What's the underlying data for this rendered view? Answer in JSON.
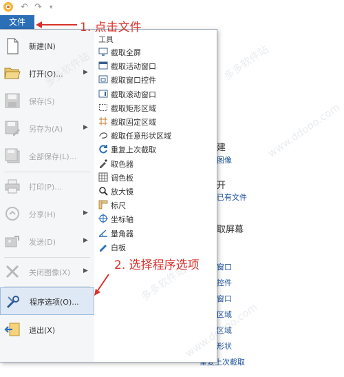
{
  "quick_access": {
    "app_icon": "app-logo-icon",
    "undo_icon": "undo-icon",
    "redo_icon": "redo-icon",
    "customize_icon": "dropdown-icon"
  },
  "file_tab": {
    "label": "文件"
  },
  "menu_items": [
    {
      "label": "新建(N)",
      "icon": "new-file-icon",
      "submenu": false,
      "disabled": false
    },
    {
      "label": "打开(O)...",
      "icon": "open-folder-icon",
      "submenu": true,
      "disabled": false
    },
    {
      "label": "保存(S)",
      "icon": "save-icon",
      "submenu": false,
      "disabled": true
    },
    {
      "label": "另存为(A)",
      "icon": "save-as-icon",
      "submenu": true,
      "disabled": true
    },
    {
      "label": "全部保存(L)...",
      "icon": "save-all-icon",
      "submenu": false,
      "disabled": true
    },
    {
      "label": "打印(P)...",
      "icon": "print-icon",
      "submenu": false,
      "disabled": true
    },
    {
      "label": "分享(H)",
      "icon": "share-icon",
      "submenu": true,
      "disabled": true
    },
    {
      "label": "发送(D)",
      "icon": "send-icon",
      "submenu": true,
      "disabled": true
    },
    {
      "label": "关闭图像(X)",
      "icon": "close-image-icon",
      "submenu": true,
      "disabled": true
    },
    {
      "label": "程序选项(O)...",
      "icon": "wrench-icon",
      "submenu": false,
      "disabled": false,
      "selected": true
    },
    {
      "label": "退出(X)",
      "icon": "exit-icon",
      "submenu": false,
      "disabled": false
    }
  ],
  "tools": {
    "header": "工具",
    "items": [
      {
        "label": "截取全屏",
        "icon": "monitor-icon"
      },
      {
        "label": "截取活动窗口",
        "icon": "window-icon"
      },
      {
        "label": "截取窗口控件",
        "icon": "window-control-icon"
      },
      {
        "label": "截取滚动窗口",
        "icon": "scroll-window-icon"
      },
      {
        "label": "截取矩形区域",
        "icon": "rectangle-icon"
      },
      {
        "label": "截取固定区域",
        "icon": "fixed-region-icon"
      },
      {
        "label": "截取任意形状区域",
        "icon": "freeform-icon"
      },
      {
        "label": "重复上次截取",
        "icon": "repeat-icon"
      },
      {
        "label": "取色器",
        "icon": "eyedropper-icon"
      },
      {
        "label": "调色板",
        "icon": "palette-icon"
      },
      {
        "label": "放大镜",
        "icon": "magnifier-icon"
      },
      {
        "label": "标尺",
        "icon": "ruler-icon"
      },
      {
        "label": "坐标轴",
        "icon": "crosshair-icon"
      },
      {
        "label": "量角器",
        "icon": "protractor-icon"
      },
      {
        "label": "白板",
        "icon": "whiteboard-icon"
      }
    ]
  },
  "background": {
    "items": [
      "建",
      "图像",
      "开",
      "已有文件",
      "取屏幕",
      "窗口",
      "控件",
      "窗口",
      "区域",
      "区域",
      "形状",
      "重复上次截取"
    ]
  },
  "annotations": {
    "step1": "1. 点击文件",
    "step2": "2. 选择程序选项",
    "color": "#d9302b"
  },
  "watermark": "多多软件站",
  "watermark_url": "www.ddooo.com",
  "colors": {
    "file_tab": "#2b6fb7",
    "accent_text": "#1a4f9c"
  }
}
